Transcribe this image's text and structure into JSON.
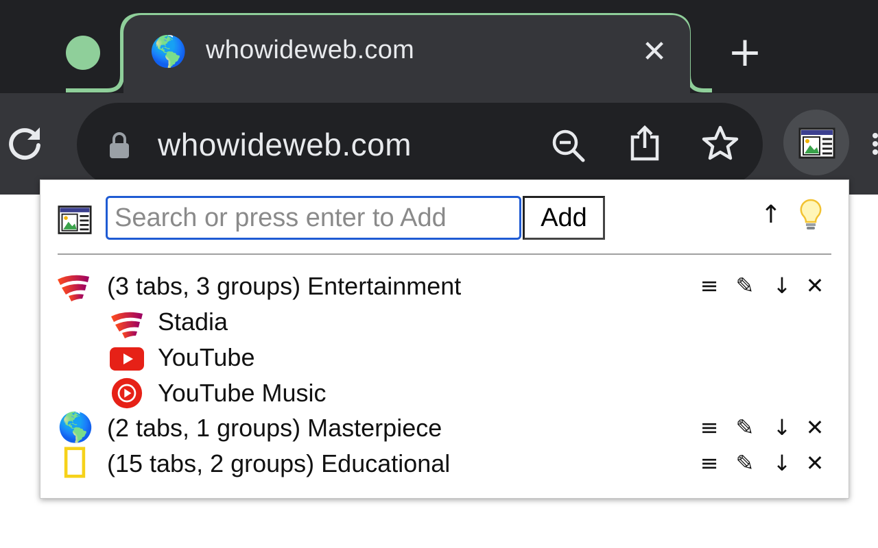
{
  "browser": {
    "tab": {
      "favicon": "🌎",
      "title": "whowideweb.com",
      "close": "✕"
    },
    "new_tab": "+",
    "address": {
      "url": "whowideweb.com"
    },
    "icons": [
      "reload-icon",
      "lock-icon",
      "zoom-out-icon",
      "share-icon",
      "bookmark-star-icon",
      "extension-icon",
      "more-menu-icon"
    ]
  },
  "popup": {
    "search": {
      "placeholder": "Search or press enter to Add",
      "value": ""
    },
    "add_label": "Add",
    "up_arrow": "↑",
    "groups": [
      {
        "label": "(3 tabs, 3 groups) Entertainment",
        "icon": "stadia-icon",
        "children": [
          {
            "label": "Stadia",
            "icon": "stadia-icon"
          },
          {
            "label": "YouTube",
            "icon": "youtube-icon"
          },
          {
            "label": "YouTube Music",
            "icon": "youtube-music-icon"
          }
        ]
      },
      {
        "label": "(2 tabs, 1 groups) Masterpiece",
        "icon": "globe-icon",
        "glyph": "🌎",
        "children": []
      },
      {
        "label": "(15 tabs, 2 groups) Educational",
        "icon": "national-geographic-icon",
        "children": []
      }
    ],
    "actions": {
      "menu": "≡",
      "edit": "✎",
      "down": "↓",
      "delete": "✕"
    }
  },
  "colors": {
    "tab_accent": "#8fcf9a",
    "search_border": "#1f5bd3",
    "youtube_red": "#e62117",
    "natgeo_yellow": "#f6d21a"
  }
}
